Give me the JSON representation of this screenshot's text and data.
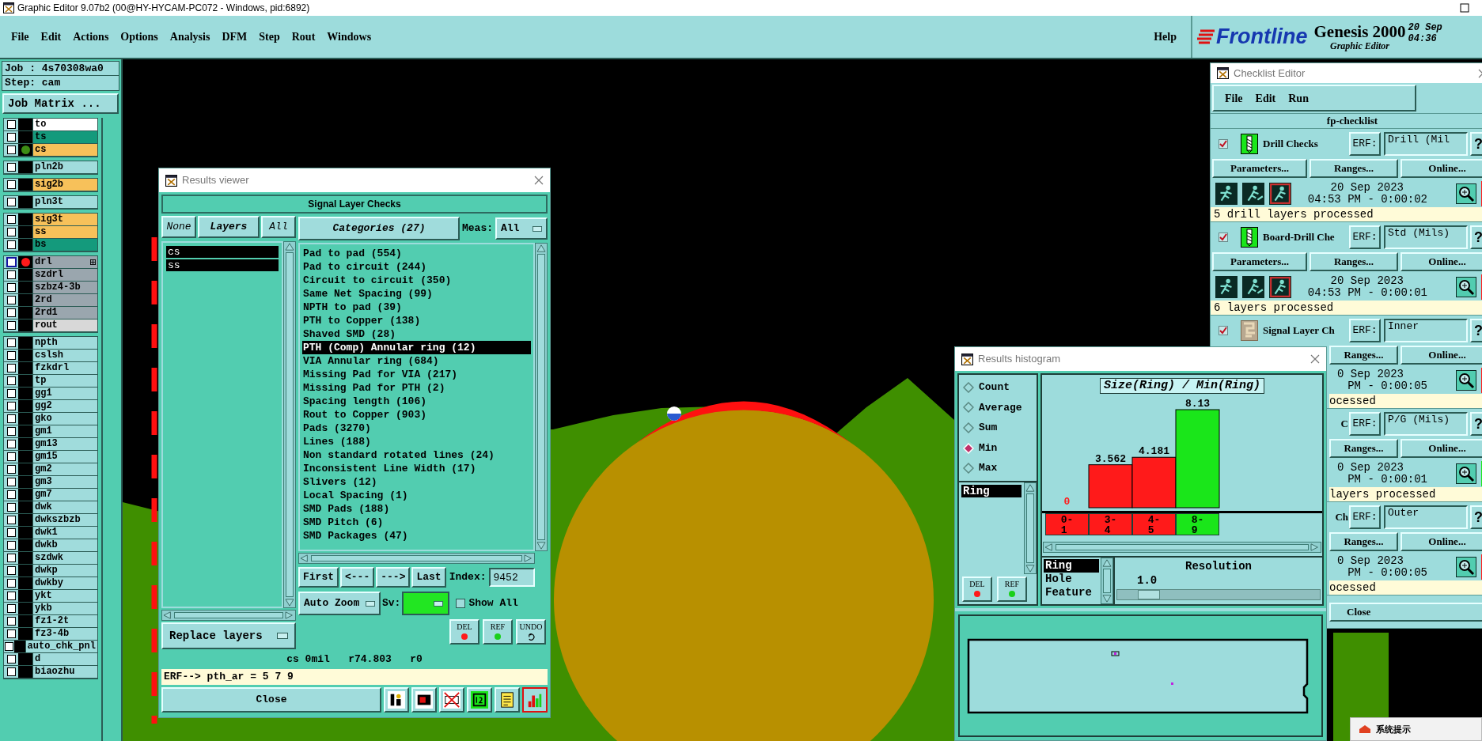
{
  "app_window": {
    "title": "Graphic Editor 9.07b2 (00@HY-HYCAM-PC072 - Windows, pid:6892)"
  },
  "menu": [
    "File",
    "Edit",
    "Actions",
    "Options",
    "Analysis",
    "DFM",
    "Step",
    "Rout",
    "Windows"
  ],
  "help_menu": "Help",
  "brand": {
    "logo": "Frontline",
    "product": "Genesis 2000",
    "subtitle": "Graphic Editor",
    "date": "20 Sep",
    "time": "04:36"
  },
  "job_panel": {
    "job": "Job : 4s70308wa0",
    "step": "Step: cam",
    "matrix_button": "Job Matrix ...",
    "layer_groups": [
      {
        "layers": [
          {
            "name": "to",
            "color": "#ffffff",
            "checked": false,
            "focused": false
          },
          {
            "name": "ts",
            "color": "#149a7c",
            "checked": false,
            "focused": false
          },
          {
            "name": "cs",
            "color": "#f7c15a",
            "checked": false,
            "focused": false,
            "marker": {
              "color": "#3c8c14"
            }
          }
        ]
      },
      {
        "layers": [
          {
            "name": "pln2b",
            "color": "#a0dcdc",
            "checked": false,
            "focused": false
          }
        ]
      },
      {
        "layers": [
          {
            "name": "sig2b",
            "color": "#f7c15a",
            "checked": false,
            "focused": false
          }
        ]
      },
      {
        "layers": [
          {
            "name": "pln3t",
            "color": "#a0dcdc",
            "checked": false,
            "focused": false
          }
        ]
      },
      {
        "layers": [
          {
            "name": "sig3t",
            "color": "#f7c15a",
            "checked": false,
            "focused": false
          },
          {
            "name": "ss",
            "color": "#f7c15a",
            "checked": false,
            "focused": false
          },
          {
            "name": "bs",
            "color": "#149a7c",
            "checked": false,
            "focused": false
          }
        ]
      },
      {
        "layers": [
          {
            "name": "drl",
            "color": "#9aa6ae",
            "checked": false,
            "focused": true,
            "marker": {
              "color": "#ff1a1a"
            }
          },
          {
            "name": "szdrl",
            "color": "#9aa6ae",
            "checked": false,
            "focused": false
          },
          {
            "name": "szbz4-3b",
            "color": "#9aa6ae",
            "checked": false,
            "focused": false
          },
          {
            "name": "2rd",
            "color": "#9aa6ae",
            "checked": false,
            "focused": false
          },
          {
            "name": "2rd1",
            "color": "#9aa6ae",
            "checked": false,
            "focused": false
          },
          {
            "name": "rout",
            "color": "#d8d8d8",
            "checked": false,
            "focused": false
          }
        ]
      },
      {
        "layers": [
          {
            "name": "npth",
            "color": "#a0dcdc",
            "checked": false,
            "focused": false
          },
          {
            "name": "cslsh",
            "color": "#a0dcdc",
            "checked": false,
            "focused": false
          },
          {
            "name": "fzkdrl",
            "color": "#a0dcdc",
            "checked": false,
            "focused": false
          },
          {
            "name": "tp",
            "color": "#a0dcdc",
            "checked": false,
            "focused": false
          },
          {
            "name": "gg1",
            "color": "#a0dcdc",
            "checked": false,
            "focused": false
          },
          {
            "name": "gg2",
            "color": "#a0dcdc",
            "checked": false,
            "focused": false
          },
          {
            "name": "gko",
            "color": "#a0dcdc",
            "checked": false,
            "focused": false
          },
          {
            "name": "gm1",
            "color": "#a0dcdc",
            "checked": false,
            "focused": false
          },
          {
            "name": "gm13",
            "color": "#a0dcdc",
            "checked": false,
            "focused": false
          },
          {
            "name": "gm15",
            "color": "#a0dcdc",
            "checked": false,
            "focused": false
          },
          {
            "name": "gm2",
            "color": "#a0dcdc",
            "checked": false,
            "focused": false
          },
          {
            "name": "gm3",
            "color": "#a0dcdc",
            "checked": false,
            "focused": false
          },
          {
            "name": "gm7",
            "color": "#a0dcdc",
            "checked": false,
            "focused": false
          },
          {
            "name": "dwk",
            "color": "#a0dcdc",
            "checked": false,
            "focused": false
          },
          {
            "name": "dwkszbzb",
            "color": "#a0dcdc",
            "checked": false,
            "focused": false
          },
          {
            "name": "dwk1",
            "color": "#a0dcdc",
            "checked": false,
            "focused": false
          },
          {
            "name": "dwkb",
            "color": "#a0dcdc",
            "checked": false,
            "focused": false
          },
          {
            "name": "szdwk",
            "color": "#a0dcdc",
            "checked": false,
            "focused": false
          },
          {
            "name": "dwkp",
            "color": "#a0dcdc",
            "checked": false,
            "focused": false
          },
          {
            "name": "dwkby",
            "color": "#a0dcdc",
            "checked": false,
            "focused": false
          },
          {
            "name": "ykt",
            "color": "#a0dcdc",
            "checked": false,
            "focused": false
          },
          {
            "name": "ykb",
            "color": "#a0dcdc",
            "checked": false,
            "focused": false
          },
          {
            "name": "fz1-2t",
            "color": "#a0dcdc",
            "checked": false,
            "focused": false
          },
          {
            "name": "fz3-4b",
            "color": "#a0dcdc",
            "checked": false,
            "focused": false
          },
          {
            "name": "auto_chk_pnl",
            "color": "#a0dcdc",
            "checked": false,
            "focused": false
          },
          {
            "name": "d",
            "color": "#a0dcdc",
            "checked": false,
            "focused": false
          },
          {
            "name": "biaozhu",
            "color": "#a0dcdc",
            "checked": false,
            "focused": false
          }
        ]
      }
    ]
  },
  "results_viewer": {
    "title": "Results viewer",
    "header": "Signal Layer Checks",
    "layer_buttons": [
      {
        "label": "None",
        "selected": false
      },
      {
        "label": "Layers",
        "selected": true
      },
      {
        "label": "All",
        "selected": false
      }
    ],
    "layers": [
      {
        "name": "cs",
        "selected": true
      },
      {
        "name": "ss",
        "selected": true
      }
    ],
    "replace_option": "Replace layers",
    "categories_button": "Categories (27)",
    "meas_label": "Meas:",
    "meas_value": "All",
    "categories": [
      {
        "label": "Pad to pad (554)",
        "selected": false
      },
      {
        "label": "Pad to circuit (244)",
        "selected": false
      },
      {
        "label": "Circuit to circuit (350)",
        "selected": false
      },
      {
        "label": "Same Net Spacing (99)",
        "selected": false
      },
      {
        "label": "NPTH to pad (39)",
        "selected": false
      },
      {
        "label": "PTH to Copper (138)",
        "selected": false
      },
      {
        "label": "Shaved SMD (28)",
        "selected": false
      },
      {
        "label": "PTH (Comp) Annular ring (12)",
        "selected": true
      },
      {
        "label": "VIA Annular ring (684)",
        "selected": false
      },
      {
        "label": "Missing Pad for VIA (217)",
        "selected": false
      },
      {
        "label": "Missing Pad for PTH (2)",
        "selected": false
      },
      {
        "label": "Spacing length (106)",
        "selected": false
      },
      {
        "label": "Rout to Copper (903)",
        "selected": false
      },
      {
        "label": "Pads (3270)",
        "selected": false
      },
      {
        "label": "Lines (188)",
        "selected": false
      },
      {
        "label": "Non standard rotated lines (24)",
        "selected": false
      },
      {
        "label": "Inconsistent Line Width (17)",
        "selected": false
      },
      {
        "label": "Slivers (12)",
        "selected": false
      },
      {
        "label": "Local Spacing (1)",
        "selected": false
      },
      {
        "label": "SMD Pads (188)",
        "selected": false
      },
      {
        "label": "SMD Pitch (6)",
        "selected": false
      },
      {
        "label": "SMD Packages (47)",
        "selected": false
      }
    ],
    "nav_buttons": [
      "First",
      "<---",
      "--->",
      "Last"
    ],
    "index_label": "Index:",
    "index_value": "9452",
    "zoom_option": "Auto Zoom",
    "sv_label": "Sv:",
    "sv": {
      "color": "#22e622"
    },
    "show_all": {
      "label": "Show All",
      "checked": false
    },
    "actions": [
      {
        "label": "DEL",
        "color": "#ff1a1a"
      },
      {
        "label": "REF",
        "color": "#1ad01a"
      },
      {
        "label": "UNDO"
      }
    ],
    "status": "cs 0mil   r74.803   r0",
    "erf_line": "ERF--> pth_ar = 5 7 9",
    "close": "Close",
    "toolbar": {
      "histogram_selected": true
    }
  },
  "checklist_editor": {
    "title": "Checklist Editor",
    "menu": [
      "File",
      "Edit",
      "Run"
    ],
    "checklist": "fp-checklist",
    "blocks": [
      {
        "kind": "drill",
        "checked": true,
        "name": "Drill Checks",
        "erf_label": "ERF:",
        "erf_value": "Drill (Mil",
        "help": "?",
        "parameters": "Parameters...",
        "ranges": "Ranges...",
        "online": "Online...",
        "date": "20 Sep 2023",
        "time": "04:53 PM - 0:00:02",
        "color": "#ff1a1a",
        "summary": "5 drill layers processed"
      },
      {
        "kind": "drill",
        "checked": true,
        "name": "Board-Drill Che",
        "erf_label": "ERF:",
        "erf_value": "Std (Mils)",
        "help": "?",
        "parameters": "Parameters...",
        "ranges": "Ranges...",
        "online": "Online...",
        "date": "20 Sep 2023",
        "time": "04:53 PM - 0:00:01",
        "color": "#ff1a1a",
        "summary": "6 layers processed"
      },
      {
        "kind": "signal",
        "checked": true,
        "name": "Signal Layer Ch",
        "erf_label": "ERF:",
        "erf_value": "Inner",
        "help": "?",
        "ranges": "Ranges...",
        "online": "Online...",
        "date": "0 Sep 2023",
        "time": "PM - 0:00:05",
        "color": "#ff1a1a",
        "summary": "ocessed"
      },
      {
        "name": "C",
        "erf_label": "ERF:",
        "erf_value": "P/G (Mils)",
        "help": "?",
        "ranges": "Ranges...",
        "online": "Online...",
        "date": "0 Sep 2023",
        "time": "PM - 0:00:01",
        "color": "#1ae61a",
        "summary": "layers processed"
      },
      {
        "name": "Ch",
        "erf_label": "ERF:",
        "erf_value": "Outer",
        "help": "?",
        "ranges": "Ranges...",
        "online": "Online...",
        "date": "0 Sep 2023",
        "time": "PM - 0:00:05",
        "color": "#ff1a1a",
        "summary": "ocessed"
      }
    ],
    "close": "Close"
  },
  "results_histogram": {
    "title": "Results histogram",
    "modes": [
      {
        "label": "Count",
        "selected": false
      },
      {
        "label": "Average",
        "selected": false
      },
      {
        "label": "Sum",
        "selected": false
      },
      {
        "label": "Min",
        "selected": true
      },
      {
        "label": "Max",
        "selected": false
      }
    ],
    "measures": [
      {
        "label": "Ring",
        "selected": true
      }
    ],
    "actions": [
      {
        "label": "DEL",
        "color": "#ff1a1a"
      },
      {
        "label": "REF",
        "color": "#1ad01a"
      }
    ],
    "chart_data": {
      "type": "bar",
      "title": "Size(Ring) / Min(Ring)",
      "categories": [
        "0-1",
        "3-4",
        "4-5",
        "8-9"
      ],
      "series": [
        {
          "colors": [
            "#ff1a1a",
            "#ff1a1a",
            "#ff1a1a",
            "#1ae61a"
          ],
          "values": [
            0,
            3.562,
            4.181,
            8.13
          ]
        }
      ],
      "data_labels": true
    },
    "size_types": [
      {
        "label": "Ring",
        "selected": true
      },
      {
        "label": "Hole",
        "selected": false
      },
      {
        "label": "Feature",
        "selected": false
      }
    ],
    "resolution_label": "Resolution",
    "resolution_value": "1.0",
    "resolution": {
      "level": 0.1
    }
  },
  "notification": {
    "title": "系统提示"
  }
}
